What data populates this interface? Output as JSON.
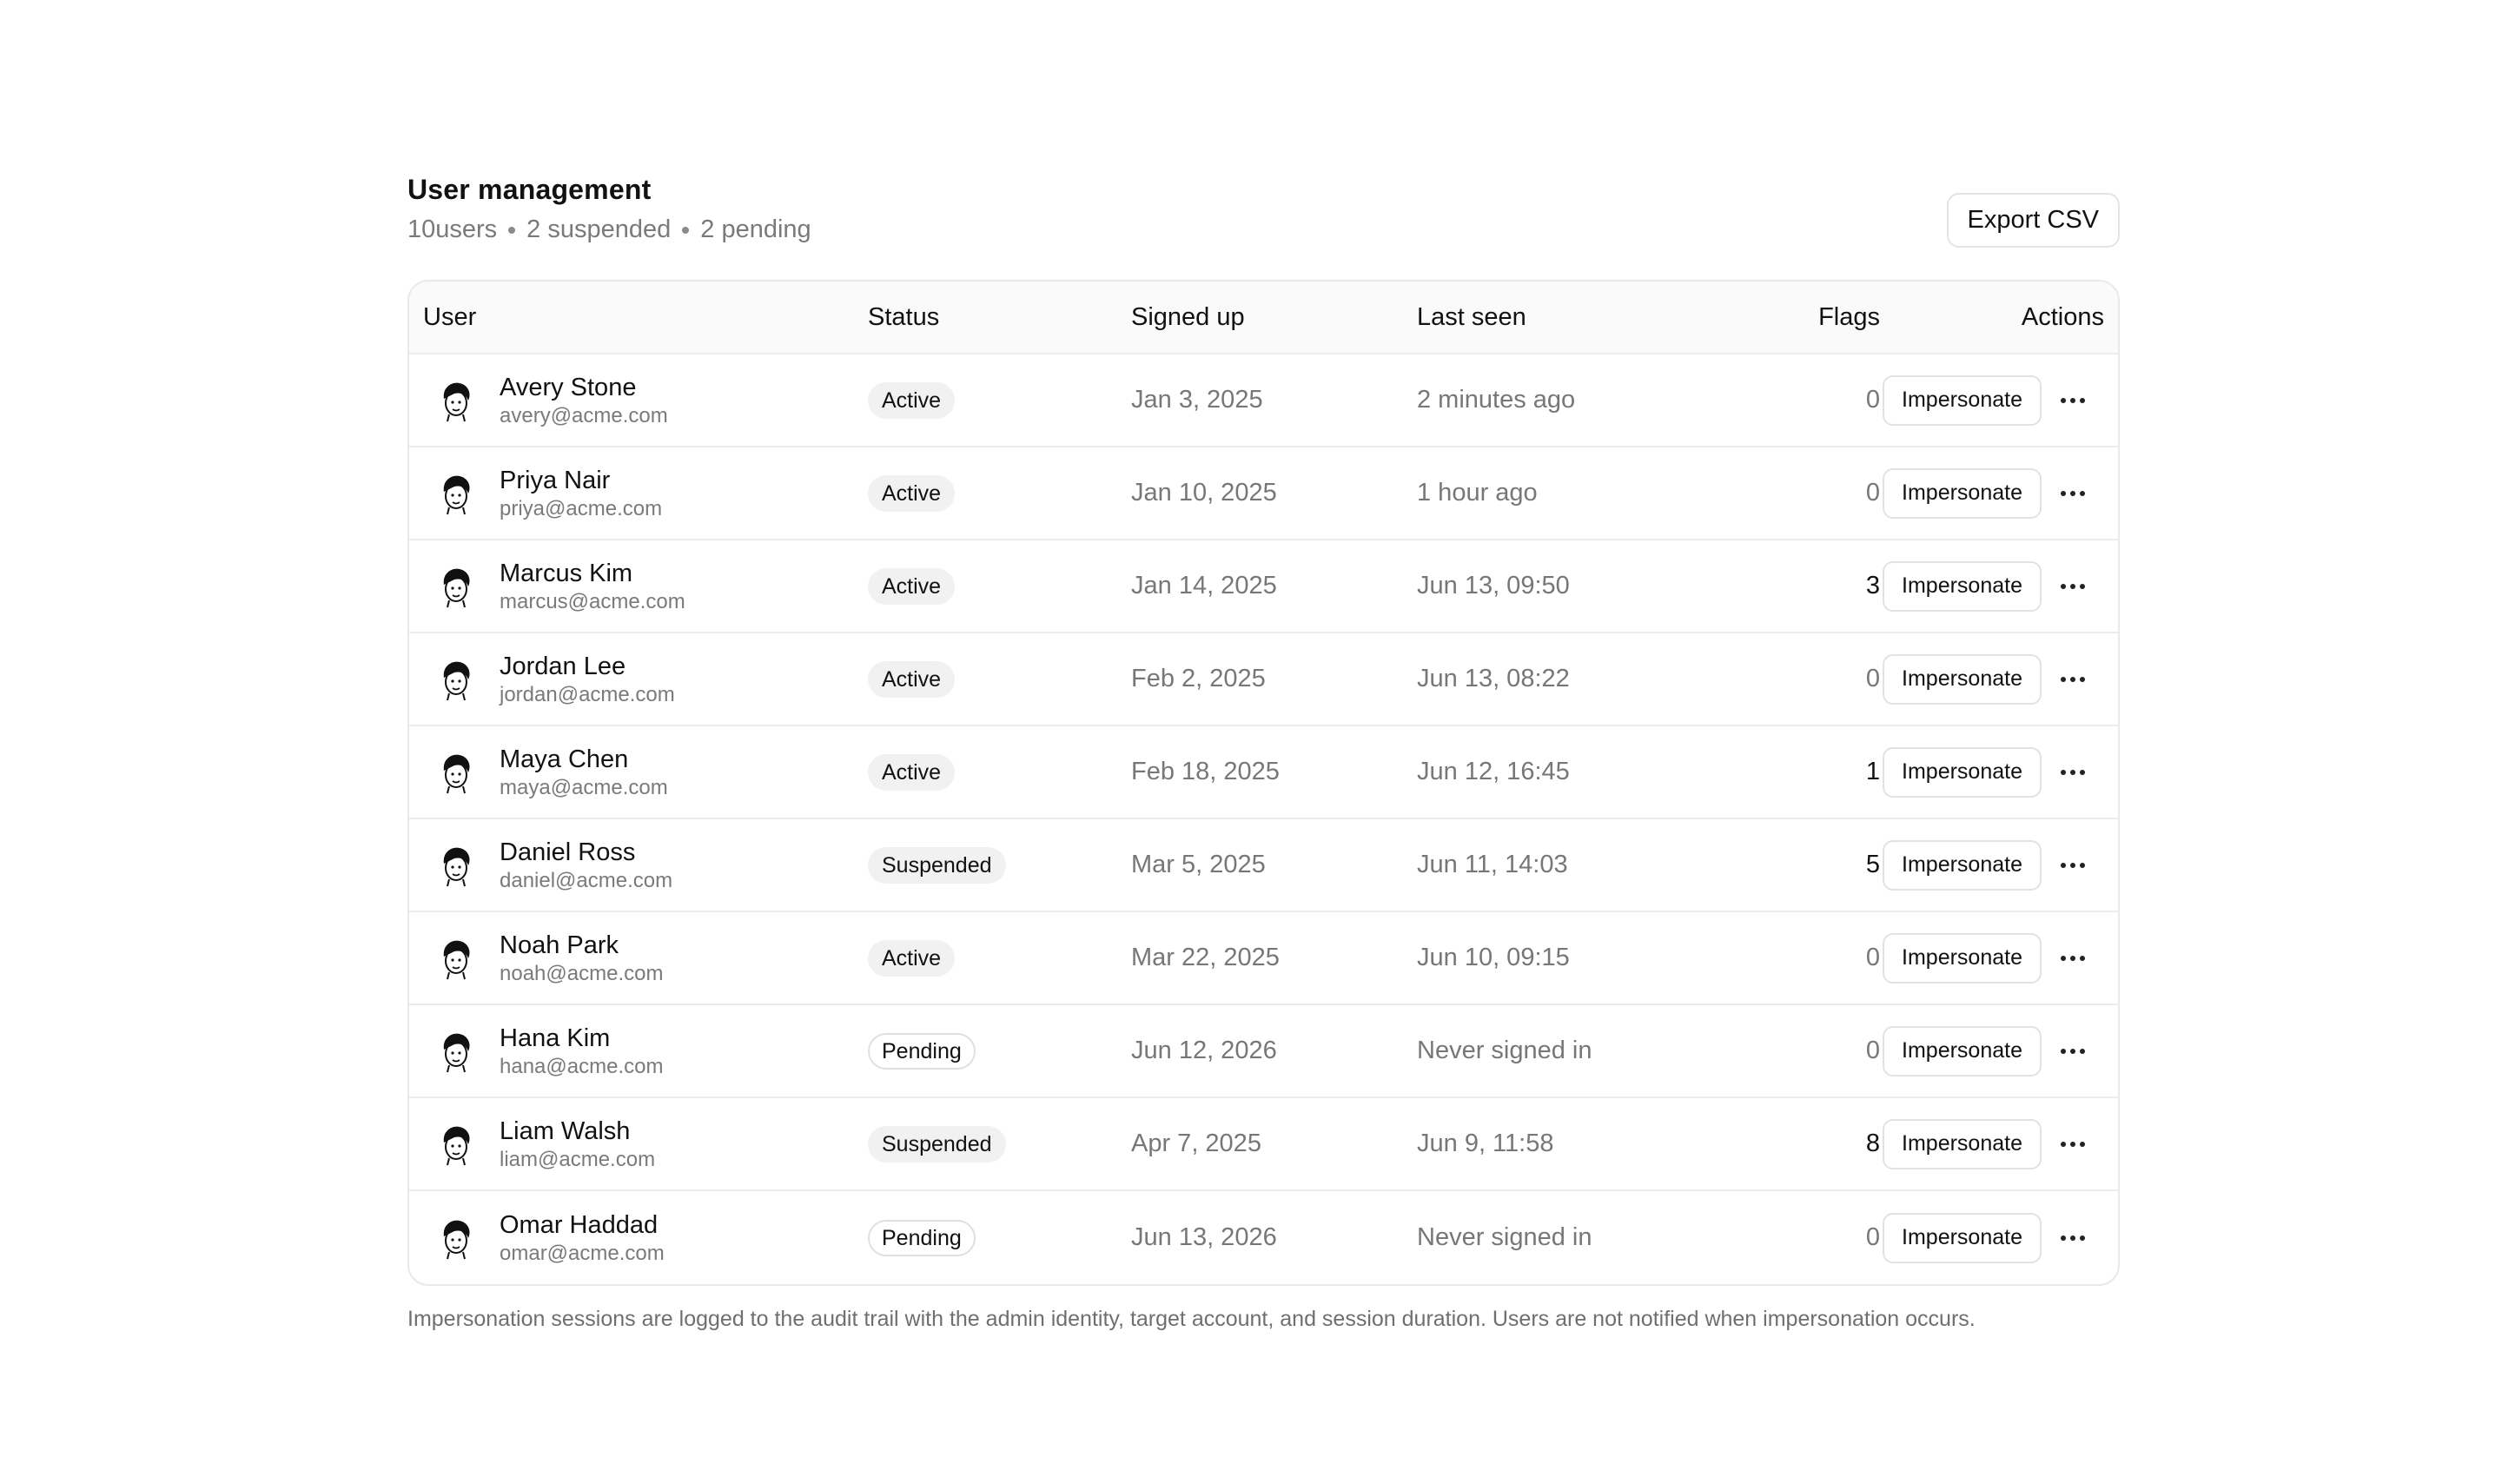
{
  "header": {
    "title": "User management",
    "summary": {
      "users": "10users",
      "suspended": "2 suspended",
      "pending": "2 pending"
    },
    "export_label": "Export CSV"
  },
  "table": {
    "columns": {
      "user": "User",
      "status": "Status",
      "signed_up": "Signed up",
      "last_seen": "Last seen",
      "flags": "Flags",
      "actions": "Actions"
    },
    "impersonate_label": "Impersonate",
    "rows": [
      {
        "name": "Avery Stone",
        "email": "avery@acme.com",
        "status": "Active",
        "signed_up": "Jan 3, 2025",
        "last_seen": "2 minutes ago",
        "flags": "0"
      },
      {
        "name": "Priya Nair",
        "email": "priya@acme.com",
        "status": "Active",
        "signed_up": "Jan 10, 2025",
        "last_seen": "1 hour ago",
        "flags": "0"
      },
      {
        "name": "Marcus Kim",
        "email": "marcus@acme.com",
        "status": "Active",
        "signed_up": "Jan 14, 2025",
        "last_seen": "Jun 13, 09:50",
        "flags": "3"
      },
      {
        "name": "Jordan Lee",
        "email": "jordan@acme.com",
        "status": "Active",
        "signed_up": "Feb 2, 2025",
        "last_seen": "Jun 13, 08:22",
        "flags": "0"
      },
      {
        "name": "Maya Chen",
        "email": "maya@acme.com",
        "status": "Active",
        "signed_up": "Feb 18, 2025",
        "last_seen": "Jun 12, 16:45",
        "flags": "1"
      },
      {
        "name": "Daniel Ross",
        "email": "daniel@acme.com",
        "status": "Suspended",
        "signed_up": "Mar 5, 2025",
        "last_seen": "Jun 11, 14:03",
        "flags": "5"
      },
      {
        "name": "Noah Park",
        "email": "noah@acme.com",
        "status": "Active",
        "signed_up": "Mar 22, 2025",
        "last_seen": "Jun 10, 09:15",
        "flags": "0"
      },
      {
        "name": "Hana Kim",
        "email": "hana@acme.com",
        "status": "Pending",
        "signed_up": "Jun 12, 2026",
        "last_seen": "Never signed in",
        "flags": "0"
      },
      {
        "name": "Liam Walsh",
        "email": "liam@acme.com",
        "status": "Suspended",
        "signed_up": "Apr 7, 2025",
        "last_seen": "Jun 9, 11:58",
        "flags": "8"
      },
      {
        "name": "Omar Haddad",
        "email": "omar@acme.com",
        "status": "Pending",
        "signed_up": "Jun 13, 2026",
        "last_seen": "Never signed in",
        "flags": "0"
      }
    ]
  },
  "footnote": "Impersonation sessions are logged to the audit trail with the admin identity, target account, and session duration. Users are not notified when impersonation occurs."
}
